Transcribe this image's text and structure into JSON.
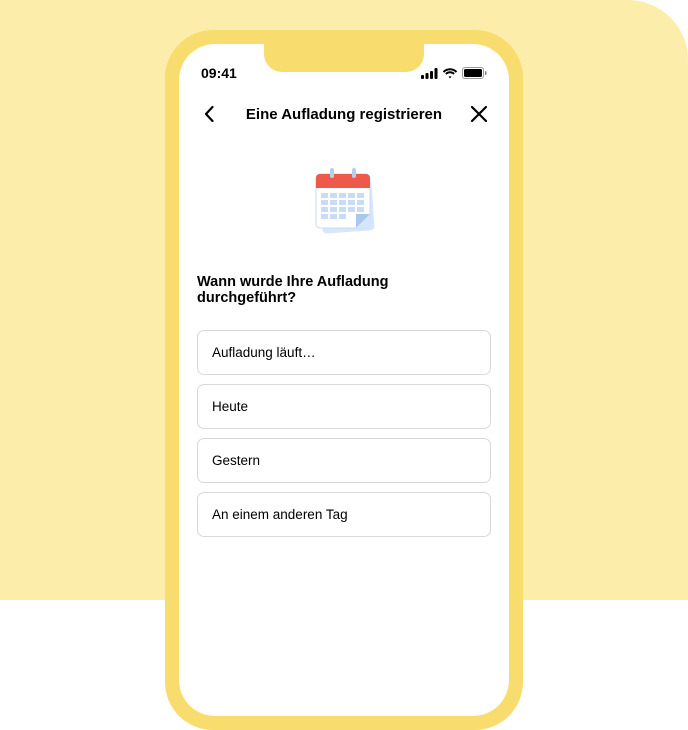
{
  "statusBar": {
    "time": "09:41"
  },
  "nav": {
    "title": "Eine Aufladung registrieren"
  },
  "question": "Wann wurde Ihre Aufladung durchgeführt?",
  "options": [
    "Aufladung läuft…",
    "Heute",
    "Gestern",
    "An einem anderen Tag"
  ]
}
